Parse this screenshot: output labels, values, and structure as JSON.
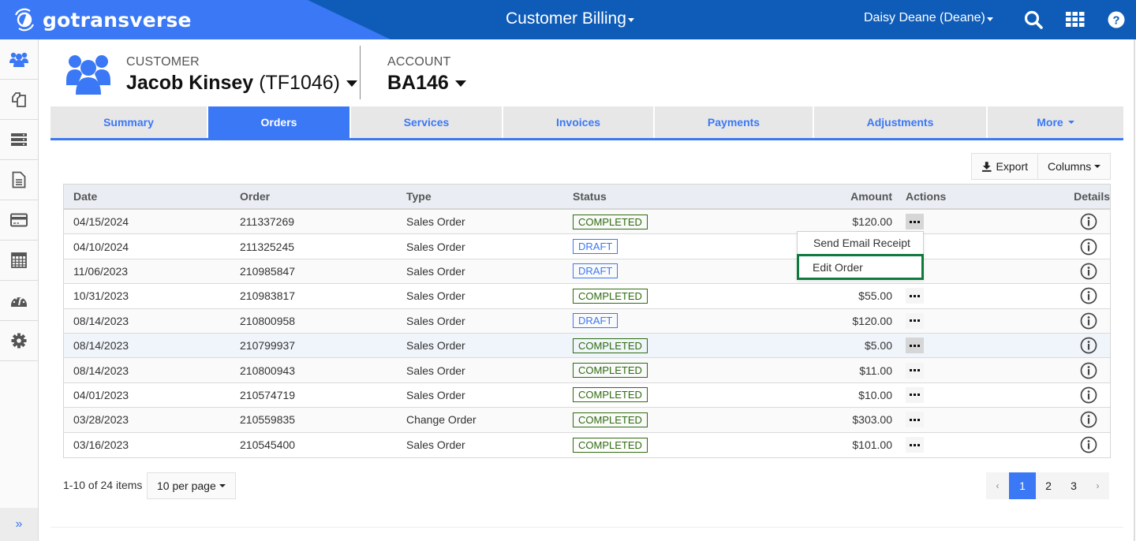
{
  "header": {
    "brand": "gotransverse",
    "app_title": "Customer Billing",
    "user": "Daisy Deane (Deane)",
    "icons": [
      "search-icon",
      "apps-grid-icon",
      "help-icon"
    ]
  },
  "sidebar": {
    "items": [
      {
        "name": "customers",
        "icon": "users-icon",
        "active": true
      },
      {
        "name": "catalog",
        "icon": "copy-icon"
      },
      {
        "name": "services",
        "icon": "server-list-icon"
      },
      {
        "name": "documents",
        "icon": "document-icon"
      },
      {
        "name": "payments",
        "icon": "credit-card-icon"
      },
      {
        "name": "calculator",
        "icon": "calculator-icon"
      },
      {
        "name": "dashboard",
        "icon": "dashboard-gauge-icon"
      },
      {
        "name": "settings",
        "icon": "gear-icon"
      }
    ],
    "collapse_label": "»"
  },
  "customer": {
    "label": "CUSTOMER",
    "name": "Jacob Kinsey",
    "id": "(TF1046)"
  },
  "account": {
    "label": "ACCOUNT",
    "value": "BA146"
  },
  "tabs": [
    {
      "label": "Summary"
    },
    {
      "label": "Orders",
      "active": true
    },
    {
      "label": "Services"
    },
    {
      "label": "Invoices"
    },
    {
      "label": "Payments"
    },
    {
      "label": "Adjustments"
    },
    {
      "label": "More"
    }
  ],
  "toolbar": {
    "export_label": "Export",
    "columns_label": "Columns"
  },
  "table": {
    "columns": [
      "Date",
      "Order",
      "Type",
      "Status",
      "Amount",
      "Actions",
      "Details"
    ],
    "rows": [
      {
        "date": "04/15/2024",
        "order": "211337269",
        "type": "Sales Order",
        "status": "COMPLETED",
        "amount": "$120.00"
      },
      {
        "date": "04/10/2024",
        "order": "211325245",
        "type": "Sales Order",
        "status": "DRAFT",
        "amount": ""
      },
      {
        "date": "11/06/2023",
        "order": "210985847",
        "type": "Sales Order",
        "status": "DRAFT",
        "amount": ""
      },
      {
        "date": "10/31/2023",
        "order": "210983817",
        "type": "Sales Order",
        "status": "COMPLETED",
        "amount": "$55.00"
      },
      {
        "date": "08/14/2023",
        "order": "210800958",
        "type": "Sales Order",
        "status": "DRAFT",
        "amount": "$120.00"
      },
      {
        "date": "08/14/2023",
        "order": "210799937",
        "type": "Sales Order",
        "status": "COMPLETED",
        "amount": "$5.00"
      },
      {
        "date": "08/14/2023",
        "order": "210800943",
        "type": "Sales Order",
        "status": "COMPLETED",
        "amount": "$11.00"
      },
      {
        "date": "04/01/2023",
        "order": "210574719",
        "type": "Sales Order",
        "status": "COMPLETED",
        "amount": "$10.00"
      },
      {
        "date": "03/28/2023",
        "order": "210559835",
        "type": "Change Order",
        "status": "COMPLETED",
        "amount": "$303.00"
      },
      {
        "date": "03/16/2023",
        "order": "210545400",
        "type": "Sales Order",
        "status": "COMPLETED",
        "amount": "$101.00"
      }
    ]
  },
  "actions_menu": {
    "items": [
      "Send Email Receipt",
      "Edit Order"
    ],
    "highlighted": "Edit Order"
  },
  "pagination": {
    "summary": "1-10 of 24 items",
    "per_page": "10 per page",
    "pages": [
      "1",
      "2",
      "3"
    ],
    "current": "1",
    "prev": "‹",
    "next": "›"
  },
  "colors": {
    "brand_blue": "#3b78f5",
    "header_dark": "#0f5cb8",
    "completed": "#2f6b0f",
    "draft": "#3b78f5",
    "highlight_border": "#0e7a3e"
  }
}
